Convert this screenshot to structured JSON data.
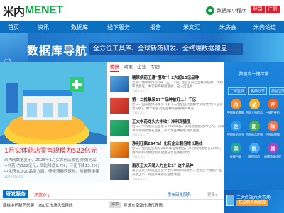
{
  "header": {
    "logo_mi": "米内",
    "logo_menet": "MENET",
    "mini_program": "数据库小程序",
    "login": "登录",
    "register": "注册"
  },
  "nav": {
    "items": [
      "首页",
      "资讯",
      "数据库",
      "线下服务",
      "报告",
      "米文汇",
      "米房会",
      "米内论道"
    ]
  },
  "banner": {
    "title": "数据库导航",
    "subtitle": "全方位工具库、全球新药研发、全终端数据覆盖......",
    "ad_tag": "广告"
  },
  "hero": {
    "headline": "1月实体药店零售规模为522亿元",
    "summary": "米内网数据显示，2026年1月实体药店零售规模(药品+非药)为522亿元，同比降低1.7%，环比下降13.2%；中化药TOP20品类方面，停咳清肺药退热、创新药接棒",
    "date": "2026-03-14"
  },
  "news": {
    "tabs": [
      "资讯",
      "政策",
      "企业",
      "专题"
    ],
    "items": [
      {
        "title": "糖尿病药王遭\"围攻\"！2大超10亿品种",
        "summary": "近期，糖尿病用药 (以一五、下同) 通过多家企业集采挂牌，市场环境变化，本次采购规则增加，这一药品新",
        "date": "2026-03-13"
      },
      {
        "title": "第十二批集采17个品种被盯上！千亿",
        "summary": "近日，国家医保局发布《第十二批全国药品集中采购文件》(征求意见稿)，数个被提及的品种有望被纳入集采。",
        "date": "2026-03-13"
      },
      {
        "title": "正大中药龙头大丰收！净利润猛涨",
        "summary": "近日，中药龙头企业发布2025年报，实现营收超过90亿元，归母净利润同比增长显著，多个大品种销售持续放量。",
        "date": "2026-03-12"
      },
      {
        "title": "净利狂飙264%！化药企业翻倍增长路线",
        "summary": "近日，化药企业发布2025年业绩预告，净利润同比增长264%，创新药和高端仿制药放量成为主要驱动力。",
        "date": "2026-03-12"
      },
      {
        "title": "南京正大天晴入力企业1？这个品种",
        "summary": "南京正大天晴药业在多个治疗领域持续发力，近期多个重磅产品获批上市，有望带来新的业绩增量。",
        "date": "2026-03-11"
      }
    ],
    "links": [
      "导求东南亚市场代理商"
    ]
  },
  "panel": {
    "title": "数据库一键检索",
    "sub_tabs": [
      "二维监测",
      "美西沙季",
      "药品宝库"
    ],
    "tools": [
      {
        "label": "中国医药数据",
        "icon": "pill-icon",
        "color": "#ff8a1f",
        "glyph": "药"
      },
      {
        "label": "中国上市药品",
        "icon": "capsule-icon",
        "color": "#ffb020",
        "glyph": "品"
      },
      {
        "label": "一致性评价",
        "icon": "check-icon",
        "color": "#f26522",
        "glyph": "评"
      },
      {
        "label": "中国医药企业",
        "icon": "factory-icon",
        "color": "#2a9df4",
        "glyph": "企"
      },
      {
        "label": "中国药品注册",
        "icon": "document-icon",
        "color": "#4caf50",
        "glyph": "册"
      },
      {
        "label": "招投标数据",
        "icon": "gavel-icon",
        "color": "#ff7043",
        "glyph": "标"
      },
      {
        "label": "医保目录",
        "icon": "shield-icon",
        "color": "#26a69a",
        "glyph": "保"
      },
      {
        "label": "医院用药",
        "icon": "hospital-icon",
        "color": "#42a5f5",
        "glyph": "医"
      },
      {
        "label": "药物临床试验",
        "icon": "flask-icon",
        "color": "#ab47bc",
        "glyph": "验"
      }
    ]
  },
  "research": {
    "tag": "研发服务",
    "name": "药研企1",
    "publish": "发布研发服务",
    "more": "更多>",
    "entries": [
      "康缘中药新药来袭，760亿市场风云再起"
    ],
    "tags": [
      "需求"
    ]
  },
  "promo": {
    "line1": "三大终端六大市场",
    "line2": "药品销售数据库"
  }
}
